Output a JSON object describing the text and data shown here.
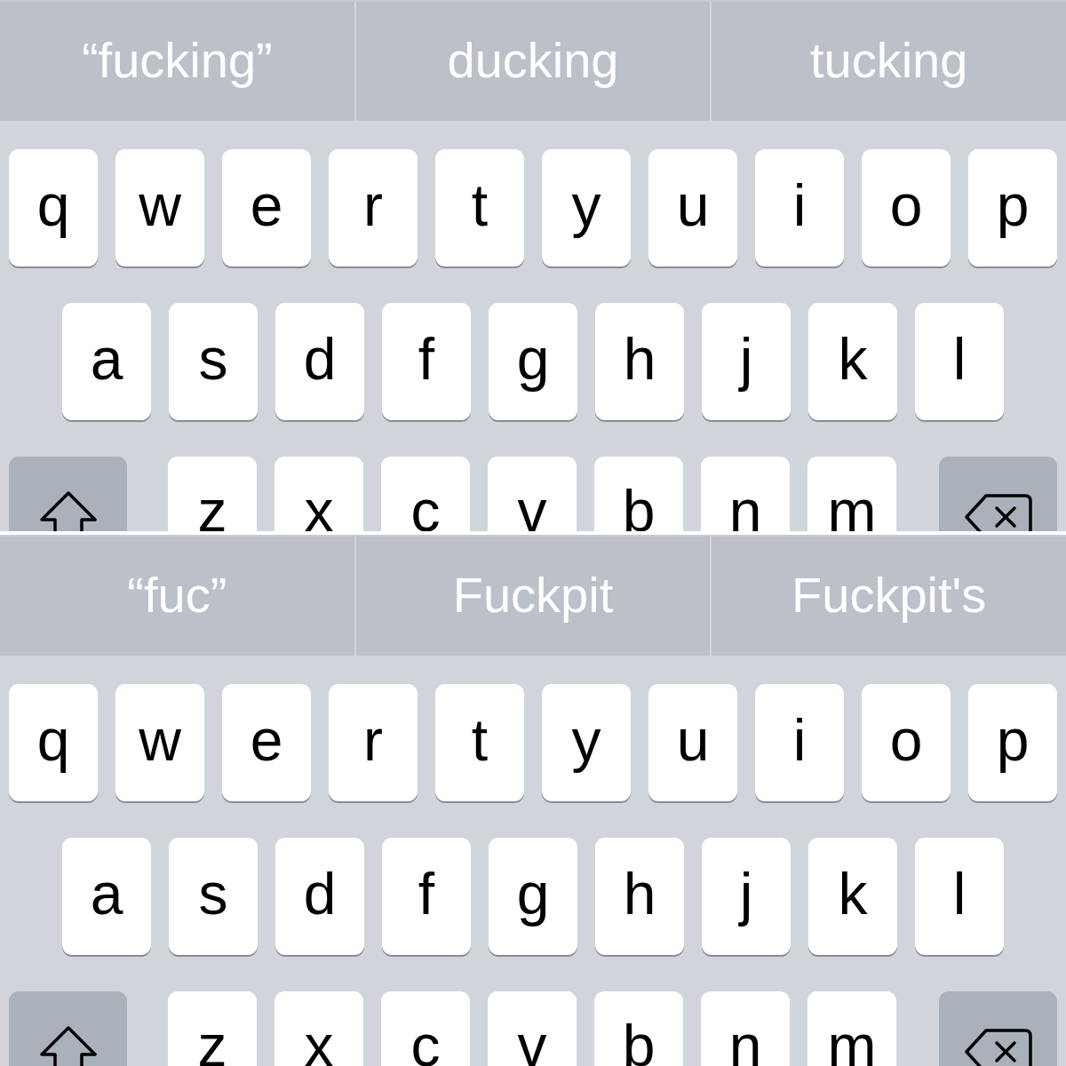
{
  "panels": [
    {
      "suggestions": [
        "“fucking”",
        "ducking",
        "tucking"
      ],
      "rows": [
        {
          "keys": [
            {
              "kind": "letter",
              "label": "q"
            },
            {
              "kind": "letter",
              "label": "w"
            },
            {
              "kind": "letter",
              "label": "e"
            },
            {
              "kind": "letter",
              "label": "r"
            },
            {
              "kind": "letter",
              "label": "t"
            },
            {
              "kind": "letter",
              "label": "y"
            },
            {
              "kind": "letter",
              "label": "u"
            },
            {
              "kind": "letter",
              "label": "i"
            },
            {
              "kind": "letter",
              "label": "o"
            },
            {
              "kind": "letter",
              "label": "p"
            }
          ]
        },
        {
          "keys": [
            {
              "kind": "letter",
              "label": "a"
            },
            {
              "kind": "letter",
              "label": "s"
            },
            {
              "kind": "letter",
              "label": "d"
            },
            {
              "kind": "letter",
              "label": "f"
            },
            {
              "kind": "letter",
              "label": "g"
            },
            {
              "kind": "letter",
              "label": "h"
            },
            {
              "kind": "letter",
              "label": "j"
            },
            {
              "kind": "letter",
              "label": "k"
            },
            {
              "kind": "letter",
              "label": "l"
            }
          ]
        },
        {
          "keys": [
            {
              "kind": "shift"
            },
            {
              "kind": "letter",
              "label": "z"
            },
            {
              "kind": "letter",
              "label": "x"
            },
            {
              "kind": "letter",
              "label": "c"
            },
            {
              "kind": "letter",
              "label": "v"
            },
            {
              "kind": "letter",
              "label": "b"
            },
            {
              "kind": "letter",
              "label": "n"
            },
            {
              "kind": "letter",
              "label": "m"
            },
            {
              "kind": "delete"
            }
          ]
        }
      ]
    },
    {
      "suggestions": [
        "“fuc”",
        "Fuckpit",
        "Fuckpit's"
      ],
      "rows": [
        {
          "keys": [
            {
              "kind": "letter",
              "label": "q"
            },
            {
              "kind": "letter",
              "label": "w"
            },
            {
              "kind": "letter",
              "label": "e"
            },
            {
              "kind": "letter",
              "label": "r"
            },
            {
              "kind": "letter",
              "label": "t"
            },
            {
              "kind": "letter",
              "label": "y"
            },
            {
              "kind": "letter",
              "label": "u"
            },
            {
              "kind": "letter",
              "label": "i"
            },
            {
              "kind": "letter",
              "label": "o"
            },
            {
              "kind": "letter",
              "label": "p"
            }
          ]
        },
        {
          "keys": [
            {
              "kind": "letter",
              "label": "a"
            },
            {
              "kind": "letter",
              "label": "s"
            },
            {
              "kind": "letter",
              "label": "d"
            },
            {
              "kind": "letter",
              "label": "f"
            },
            {
              "kind": "letter",
              "label": "g"
            },
            {
              "kind": "letter",
              "label": "h"
            },
            {
              "kind": "letter",
              "label": "j"
            },
            {
              "kind": "letter",
              "label": "k"
            },
            {
              "kind": "letter",
              "label": "l"
            }
          ]
        },
        {
          "keys": [
            {
              "kind": "shift"
            },
            {
              "kind": "letter",
              "label": "z"
            },
            {
              "kind": "letter",
              "label": "x"
            },
            {
              "kind": "letter",
              "label": "c"
            },
            {
              "kind": "letter",
              "label": "v"
            },
            {
              "kind": "letter",
              "label": "b"
            },
            {
              "kind": "letter",
              "label": "n"
            },
            {
              "kind": "letter",
              "label": "m"
            },
            {
              "kind": "delete"
            }
          ]
        }
      ]
    }
  ]
}
